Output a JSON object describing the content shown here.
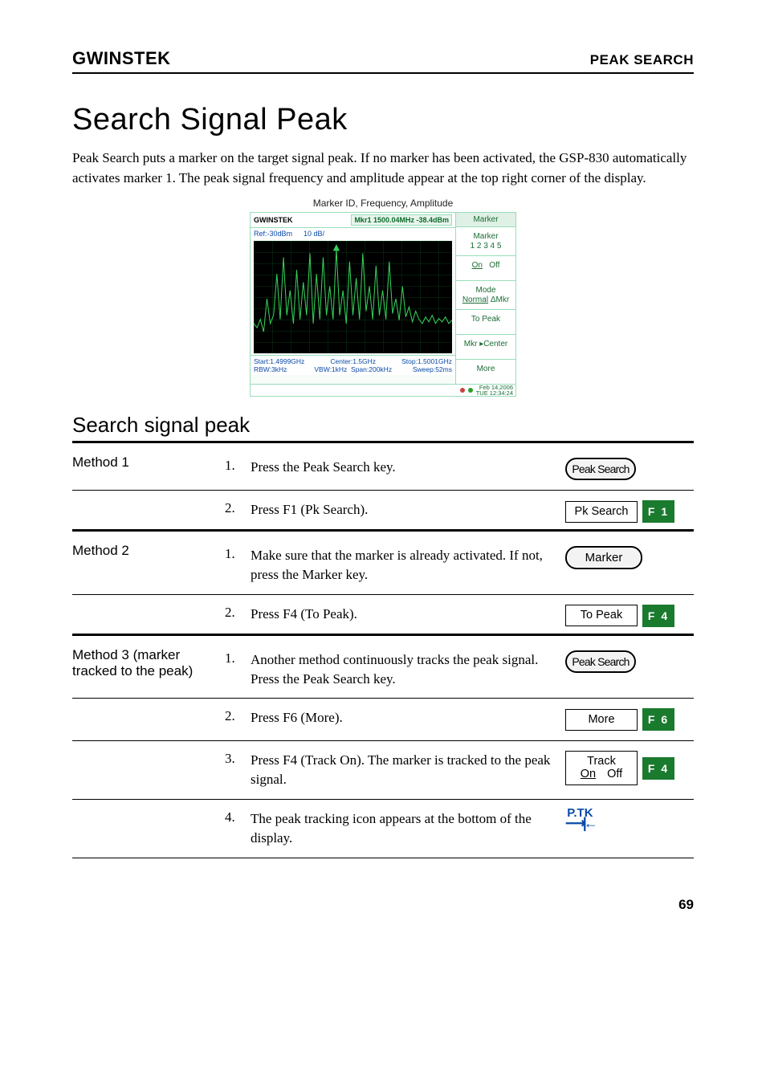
{
  "header": {
    "brand": "GWINSTEK",
    "breadcrumb": "PEAK SEARCH"
  },
  "title": "Search Signal Peak",
  "intro": "Peak Search puts a marker on the target signal peak. If no marker has been activated, the GSP-830 automatically activates marker 1. The peak signal frequency and amplitude appear at the top right corner of the display.",
  "figure": {
    "top_caption": "Marker ID, Frequency, Amplitude",
    "brand": "GWINSTEK",
    "marker_readout": "Mkr1 1500.04MHz -38.4dBm",
    "ref": "Ref:-30dBm",
    "div": "10 dB/",
    "start": "Start:1.4999GHz",
    "rbw": "RBW:3kHz",
    "center": "Center:1.5GHz",
    "vbw": "VBW:1kHz",
    "span": "Span:200kHz",
    "stop": "Stop:1.5001GHz",
    "sweep": "Sweep:52ms",
    "timestamp1": "Feb 14,2006",
    "timestamp2": "TUE 12:34:24",
    "menu": {
      "title": "Marker",
      "items": [
        "Marker\n1 2 3 4 5",
        "On     Off",
        "Mode\nNormal ΔMkr",
        "To  Peak",
        "Mkr ▸Center",
        "More"
      ]
    }
  },
  "section_title": "Search signal peak",
  "methods": [
    {
      "label": "Method 1",
      "steps": [
        {
          "num": "1.",
          "text": "Press the Peak Search key.",
          "widget": {
            "type": "hardkey",
            "label": "Peak Search",
            "tight": true
          }
        },
        {
          "num": "2.",
          "text": "Press F1 (Pk Search).",
          "widget": {
            "type": "soft+f",
            "soft": "Pk Search",
            "f": "F 1"
          }
        }
      ]
    },
    {
      "label": "Method 2",
      "steps": [
        {
          "num": "1.",
          "text": "Make sure that the marker is already activated. If not, press the Marker key.",
          "widget": {
            "type": "hardkey",
            "label": "Marker"
          }
        },
        {
          "num": "2.",
          "text": "Press F4 (To Peak).",
          "widget": {
            "type": "soft+f",
            "soft": "To Peak",
            "f": "F 4"
          }
        }
      ]
    },
    {
      "label": "Method 3 (marker tracked to the peak)",
      "steps": [
        {
          "num": "1.",
          "text": "Another method continuously tracks the peak signal. Press the Peak Search key.",
          "widget": {
            "type": "hardkey",
            "label": "Peak Search",
            "tight": true
          }
        },
        {
          "num": "2.",
          "text": "Press F6 (More).",
          "widget": {
            "type": "soft+f",
            "soft": "More",
            "f": "F 6"
          }
        },
        {
          "num": "3.",
          "text": "Press F4 (Track On). The marker is tracked to the peak signal.",
          "widget": {
            "type": "track+f",
            "top": "Track",
            "on": "On",
            "off": "Off",
            "f": "F 4"
          }
        },
        {
          "num": "4.",
          "text": "The peak tracking icon appears at the bottom of the display.",
          "widget": {
            "type": "ptk"
          }
        }
      ]
    }
  ],
  "page_number": "69"
}
